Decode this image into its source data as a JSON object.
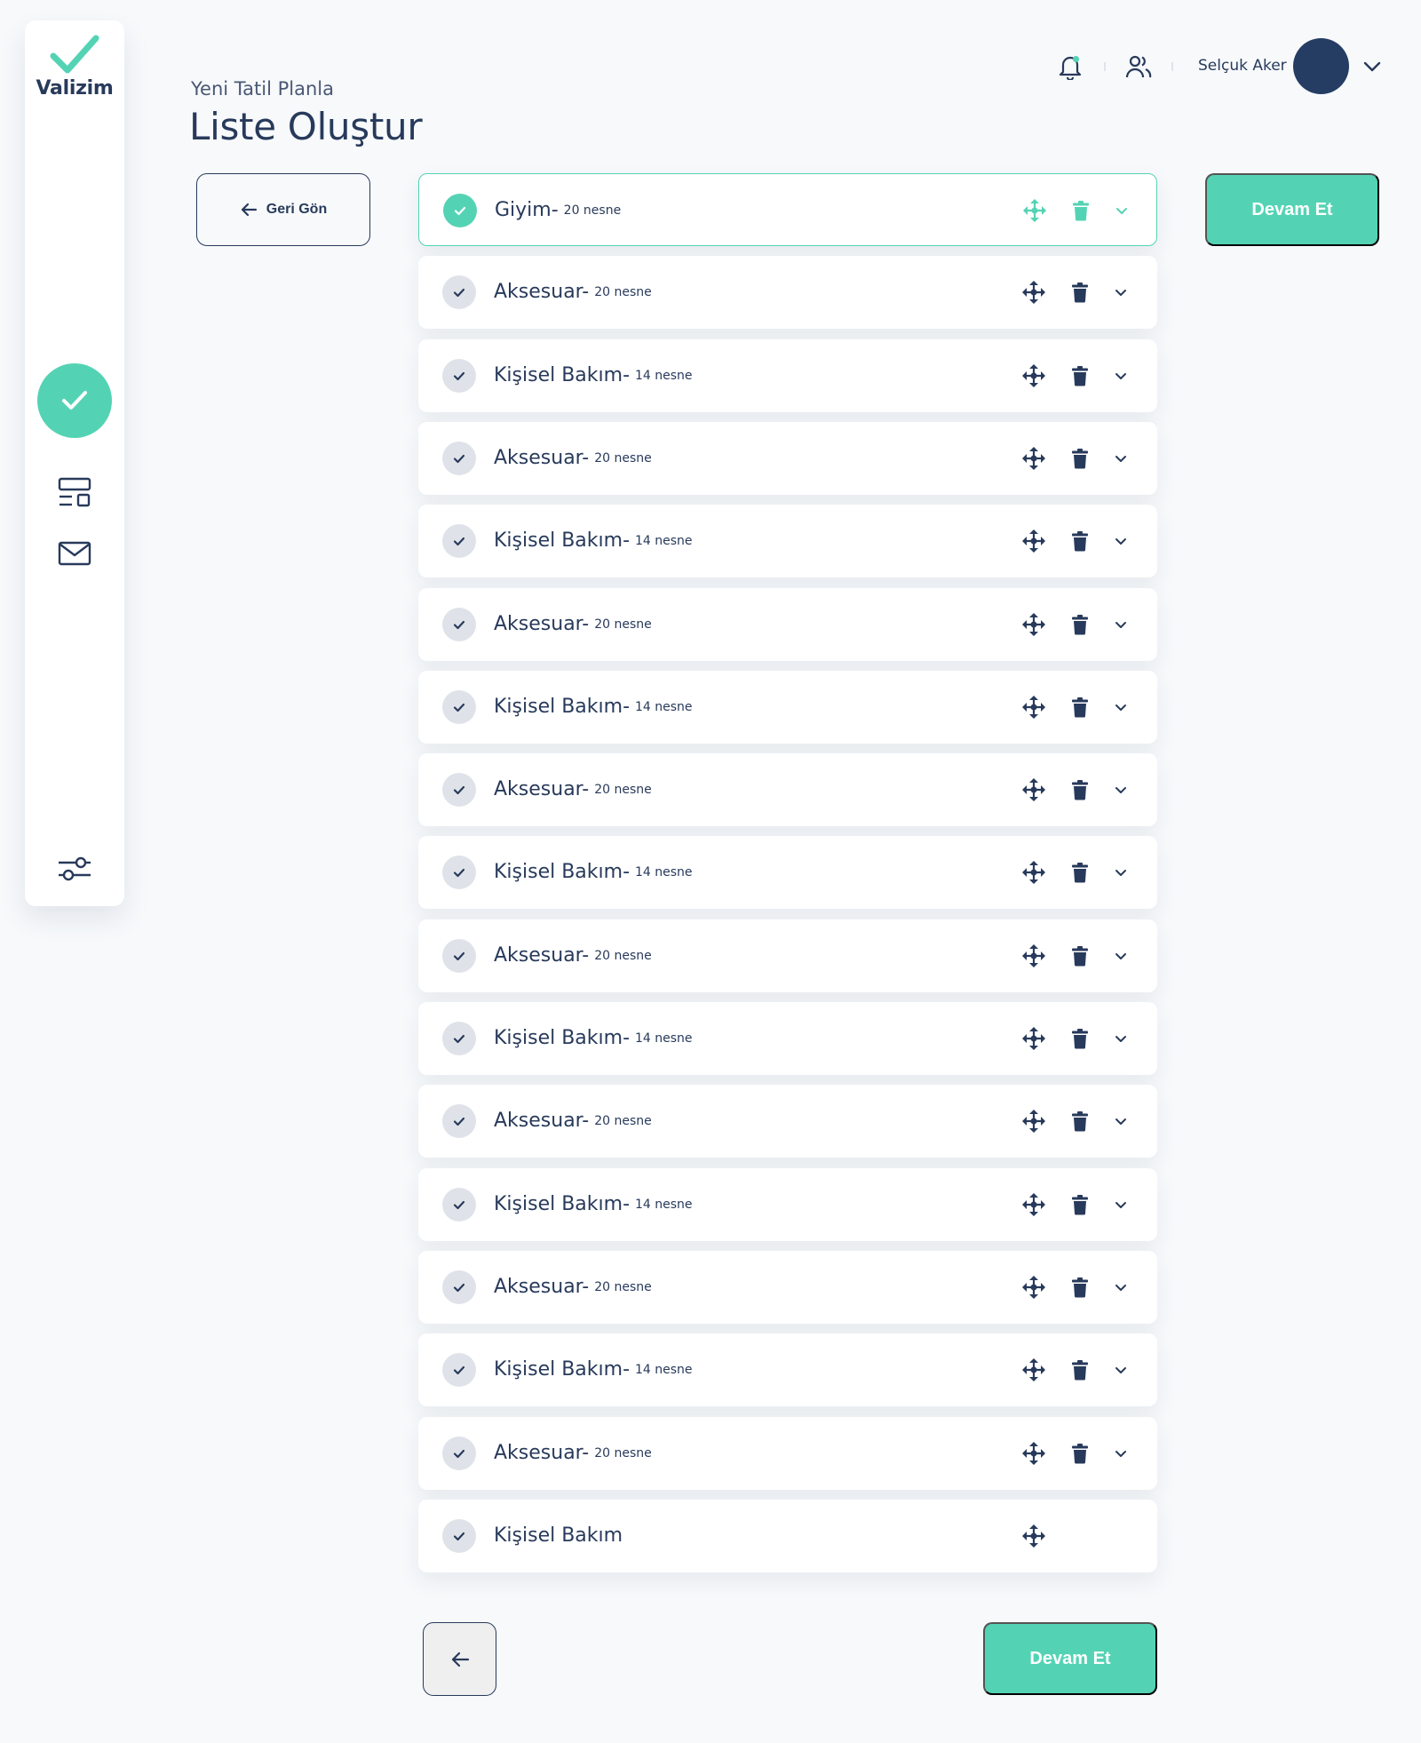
{
  "app": {
    "logo_text": "Valizim"
  },
  "header": {
    "subtitle": "Yeni Tatil Planla",
    "title": "Liste Oluştur",
    "user_name": "Selçuk Aker"
  },
  "actions": {
    "back_label": "Geri Gön",
    "continue_label": "Devam Et",
    "continue_bottom_label": "Devam Et"
  },
  "colors": {
    "accent": "#54d3b4",
    "navy": "#283a5b",
    "avatar": "#253d63",
    "background": "#f7f9fb"
  },
  "sidebar": {
    "icons": [
      "check-icon",
      "layout-icon",
      "mail-icon",
      "sliders-icon"
    ]
  },
  "categories": [
    {
      "name": "Giyim-",
      "count": "20 nesne",
      "active": true
    },
    {
      "name": "Aksesuar-",
      "count": "20 nesne"
    },
    {
      "name": "Kişisel Bakım-",
      "count": "14 nesne"
    },
    {
      "name": "Aksesuar-",
      "count": "20 nesne"
    },
    {
      "name": "Kişisel Bakım-",
      "count": "14 nesne"
    },
    {
      "name": "Aksesuar-",
      "count": "20 nesne"
    },
    {
      "name": "Kişisel Bakım-",
      "count": "14 nesne"
    },
    {
      "name": "Aksesuar-",
      "count": "20 nesne"
    },
    {
      "name": "Kişisel Bakım-",
      "count": "14 nesne"
    },
    {
      "name": "Aksesuar-",
      "count": "20 nesne"
    },
    {
      "name": "Kişisel Bakım-",
      "count": "14 nesne"
    },
    {
      "name": "Aksesuar-",
      "count": "20 nesne"
    },
    {
      "name": "Kişisel Bakım-",
      "count": "14 nesne"
    },
    {
      "name": "Aksesuar-",
      "count": "20 nesne"
    },
    {
      "name": "Kişisel Bakım-",
      "count": "14 nesne"
    },
    {
      "name": "Aksesuar-",
      "count": "20 nesne"
    },
    {
      "name": "Kişisel Bakım",
      "count": "",
      "dragging": true
    }
  ]
}
